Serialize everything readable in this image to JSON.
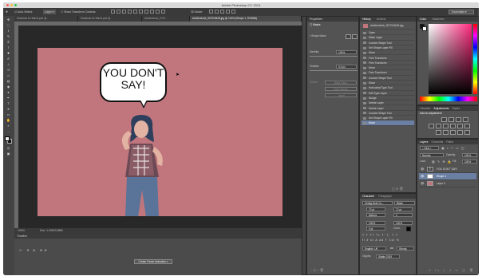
{
  "window": {
    "title": "Adobe Photoshop CC 2014"
  },
  "options_bar": {
    "auto_select_label": "Auto-Select:",
    "auto_select_value": "Layer",
    "show_transform_label": "Show Transform Controls",
    "workspace": "Essentials"
  },
  "doc_tabs": [
    {
      "label": "Shadows for Barrel.psd @..."
    },
    {
      "label": "Shadows for Barrel.psd @..."
    },
    {
      "label": "shutterstock_1072..."
    },
    {
      "label": "shutterstock_307218449.jpg @ 100% (Shape 1, RGB/8#)"
    }
  ],
  "speech_bubble": {
    "line1": "YOU DON'T",
    "line2": "SAY!"
  },
  "status_bar": {
    "zoom": "100%",
    "doc_info": "Doc: 1.93M/3.88M"
  },
  "timeline": {
    "tab_label": "Timeline",
    "button_label": "Create Frame Animation"
  },
  "properties": {
    "tab_label": "Properties",
    "header": "Masks",
    "shape_mask_label": "Shape Mask",
    "density_label": "Density:",
    "density_value": "100%",
    "feather_label": "Feather:",
    "feather_value": "0.0 px",
    "refine_label": "Refine:",
    "mask_edge_label": "Mask Edge...",
    "color_range_label": "Color Range...",
    "invert_label": "Invert"
  },
  "history": {
    "tabs": [
      "History",
      "Actions"
    ],
    "snapshot": "shutterstock_307218449.jpg",
    "items": [
      "Open",
      "Make Layer",
      "Custom Shape Tool",
      "Set Shape Layer Fill",
      "Move",
      "Free Transform",
      "Free Transform",
      "Move",
      "Free Transform",
      "Custom Shape Tool",
      "Move",
      "Horizontal Type Tool",
      "Edit Type Layer",
      "Nudge",
      "Delete Layer",
      "Delete Layer",
      "Custom Shape Tool",
      "Set Shape Layer Fill",
      "Move"
    ]
  },
  "color_panel": {
    "tabs": [
      "Color",
      "Swatches"
    ]
  },
  "adjustments": {
    "tabs": [
      "Libraries",
      "Adjustments",
      "Styles"
    ],
    "header": "Add an adjustment"
  },
  "layers": {
    "tabs": [
      "Layers",
      "Channels",
      "Paths"
    ],
    "kind_label": "Kind",
    "blend_mode": "Normal",
    "opacity_label": "Opacity:",
    "opacity_value": "100%",
    "lock_label": "Lock:",
    "fill_label": "Fill:",
    "fill_value": "100%",
    "items": [
      {
        "name": "YOU DON'T SAY!",
        "thumb": "T"
      },
      {
        "name": "Shape 1",
        "thumb": ""
      },
      {
        "name": "Layer 0",
        "thumb": ""
      }
    ]
  },
  "character": {
    "tabs": [
      "Character",
      "Paragraph"
    ],
    "font_family": "Verlag Bold Co...",
    "font_style": "Black",
    "font_size": "72 pt",
    "leading": "72 pt",
    "kerning": "Metrics",
    "tracking": "0",
    "vscale": "100%",
    "hscale": "100%",
    "baseline": "0 pt",
    "color_label": "Color:",
    "language": "English: UK",
    "aa_label": "aa",
    "aa_value": "Strong",
    "glyph_label": "Glyphs:",
    "glyph_value": "Stable 2019"
  }
}
